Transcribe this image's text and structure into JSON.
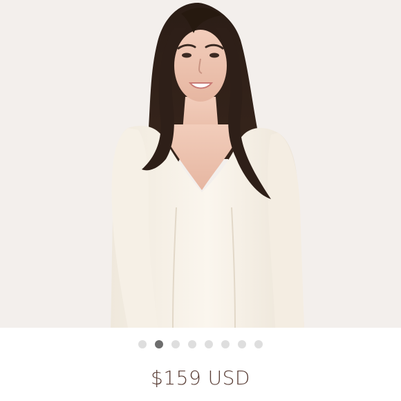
{
  "product": {
    "image": {
      "description_icon": "product-photo"
    },
    "carousel": {
      "count": 8,
      "active_index": 1
    },
    "price": "$159 USD"
  },
  "colors": {
    "image_background": "#f3efec",
    "dot_inactive": "#dedede",
    "dot_active": "#6e6e6e",
    "price_text": "#5a3e36"
  }
}
